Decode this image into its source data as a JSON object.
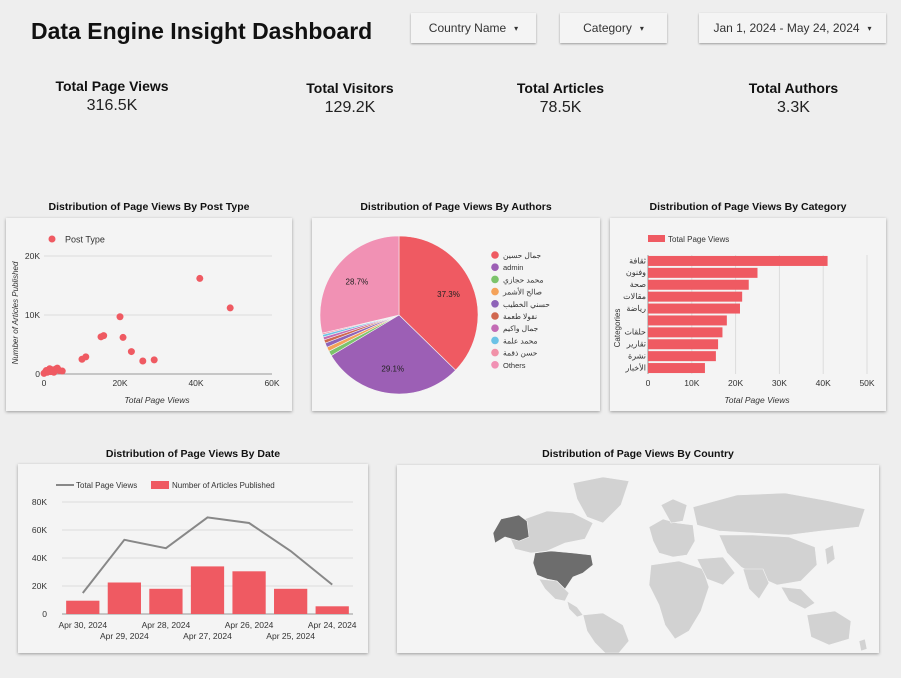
{
  "header": {
    "title": "Data Engine Insight Dashboard",
    "filters": [
      {
        "label": "Country Name"
      },
      {
        "label": "Category"
      },
      {
        "label": "Jan 1, 2024 - May 24, 2024"
      }
    ]
  },
  "kpis": [
    {
      "label": "Total Page Views",
      "value": "316.5K"
    },
    {
      "label": "Total Visitors",
      "value": "129.2K"
    },
    {
      "label": "Total Articles",
      "value": "78.5K"
    },
    {
      "label": "Total Authors",
      "value": "3.3K"
    }
  ],
  "chart_data": [
    {
      "type": "scatter",
      "title": "Distribution of Page Views By Post Type",
      "xlabel": "Total Page Views",
      "ylabel": "Number of Articles Published",
      "legend": [
        "Post Type"
      ],
      "color": "#ef5a62",
      "xlim": [
        0,
        60000
      ],
      "ylim": [
        0,
        20000
      ],
      "x_ticks": [
        "0",
        "20K",
        "40K",
        "60K"
      ],
      "y_ticks": [
        "0",
        "10K",
        "20K"
      ],
      "points": [
        {
          "x": 0,
          "y": 100
        },
        {
          "x": 300,
          "y": 300
        },
        {
          "x": 600,
          "y": 600
        },
        {
          "x": 900,
          "y": 300
        },
        {
          "x": 1200,
          "y": 500
        },
        {
          "x": 1500,
          "y": 900
        },
        {
          "x": 1800,
          "y": 400
        },
        {
          "x": 2200,
          "y": 700
        },
        {
          "x": 2600,
          "y": 300
        },
        {
          "x": 3000,
          "y": 800
        },
        {
          "x": 3500,
          "y": 1000
        },
        {
          "x": 4000,
          "y": 600
        },
        {
          "x": 4800,
          "y": 500
        },
        {
          "x": 10000,
          "y": 2500
        },
        {
          "x": 11000,
          "y": 2900
        },
        {
          "x": 15000,
          "y": 6300
        },
        {
          "x": 15700,
          "y": 6500
        },
        {
          "x": 20000,
          "y": 9700
        },
        {
          "x": 20800,
          "y": 6200
        },
        {
          "x": 23000,
          "y": 3800
        },
        {
          "x": 26000,
          "y": 2200
        },
        {
          "x": 29000,
          "y": 2400
        },
        {
          "x": 41000,
          "y": 16200
        },
        {
          "x": 49000,
          "y": 11200
        }
      ]
    },
    {
      "type": "pie",
      "title": "Distribution of Page Views By Authors",
      "slices": [
        {
          "label": "جمال حسين",
          "value": 37.3,
          "color": "#ef5a62",
          "show_label": "37.3%"
        },
        {
          "label": "admin",
          "value": 29.1,
          "color": "#9c5fb5",
          "show_label": "29.1%"
        },
        {
          "label": "محمد حجازي",
          "value": 1.0,
          "color": "#7cc36b",
          "show_label": ""
        },
        {
          "label": "صالح الأشمر",
          "value": 0.9,
          "color": "#f4a259",
          "show_label": ""
        },
        {
          "label": "حسني الخطيب",
          "value": 0.9,
          "color": "#8e63b8",
          "show_label": ""
        },
        {
          "label": "نقولا طعمة",
          "value": 0.7,
          "color": "#d0674f",
          "show_label": ""
        },
        {
          "label": "جمال واكيم",
          "value": 0.6,
          "color": "#c36bb5",
          "show_label": ""
        },
        {
          "label": "محمد علمة",
          "value": 0.5,
          "color": "#6cc2e6",
          "show_label": ""
        },
        {
          "label": "حسن ذقمة",
          "value": 0.3,
          "color": "#f191a8",
          "show_label": ""
        },
        {
          "label": "Others",
          "value": 28.7,
          "color": "#f191b4",
          "show_label": "28.7%"
        }
      ]
    },
    {
      "type": "bar",
      "orientation": "horizontal",
      "title": "Distribution of Page Views By Category",
      "xlabel": "Total Page Views",
      "ylabel": "Categories",
      "legend": [
        "Total Page Views"
      ],
      "color": "#ef5a62",
      "xlim": [
        0,
        50000
      ],
      "x_ticks": [
        "0",
        "10K",
        "20K",
        "30K",
        "40K",
        "50K"
      ],
      "categories": [
        "ثقافة",
        "وفنون",
        "صحة",
        "مقالات",
        "رياضة",
        "",
        "حلقات",
        "تقارير",
        "نشرة",
        "الأخبار"
      ],
      "values": [
        41000,
        25000,
        23000,
        21500,
        21000,
        18000,
        17000,
        16000,
        15500,
        13000
      ]
    },
    {
      "type": "bar",
      "title": "Distribution of Page Views By Date",
      "legend": [
        "Total Page Views",
        "Number of Articles Published"
      ],
      "ylim": [
        0,
        80000
      ],
      "y_ticks": [
        "0",
        "20K",
        "40K",
        "60K",
        "80K"
      ],
      "categories": [
        "Apr 30, 2024",
        "Apr 29, 2024",
        "Apr 28, 2024",
        "Apr 27, 2024",
        "Apr 26, 2024",
        "Apr 25, 2024",
        "Apr 24, 2024"
      ],
      "series": [
        {
          "name": "Number of Articles Published",
          "type": "bar",
          "color": "#ef5a62",
          "values": [
            9500,
            22500,
            18000,
            34000,
            30500,
            18000,
            5500
          ]
        },
        {
          "name": "Total Page Views",
          "type": "line",
          "color": "#888888",
          "values": [
            15000,
            53000,
            47000,
            69000,
            65000,
            45000,
            21000
          ]
        }
      ]
    }
  ],
  "map": {
    "title": "Distribution of Page Views By Country",
    "highlight_color": "#6d6d6d",
    "base_color": "#d2d2d2"
  }
}
